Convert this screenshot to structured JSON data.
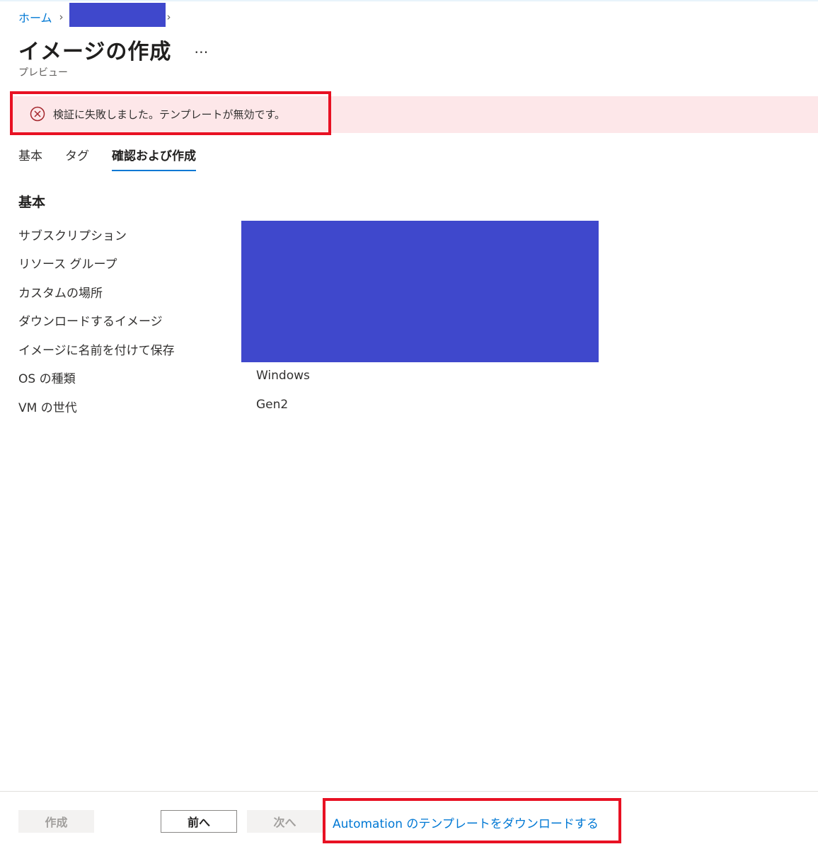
{
  "breadcrumb": {
    "home": "ホーム"
  },
  "header": {
    "title": "イメージの作成",
    "subtitle": "プレビュー",
    "more": "…"
  },
  "error": {
    "message": "検証に失敗しました。テンプレートが無効です。"
  },
  "tabs": [
    {
      "label": "基本"
    },
    {
      "label": "タグ"
    },
    {
      "label": "確認および作成",
      "active": true
    }
  ],
  "section": {
    "title": "基本",
    "rows": [
      {
        "label": "サブスクリプション",
        "value": ""
      },
      {
        "label": "リソース グループ",
        "value": ""
      },
      {
        "label": "カスタムの場所",
        "value": ""
      },
      {
        "label": "ダウンロードするイメージ",
        "value": ""
      },
      {
        "label": "イメージに名前を付けて保存",
        "value": ""
      },
      {
        "label": "OS の種類",
        "value": "Windows"
      },
      {
        "label": "VM の世代",
        "value": "Gen2"
      }
    ]
  },
  "footer": {
    "create": "作成",
    "prev": "前へ",
    "next": "次へ",
    "download_link": "Automation のテンプレートをダウンロードする"
  },
  "colors": {
    "accent": "#0078d4",
    "error": "#e81123",
    "error_bg": "#fde7e9",
    "redaction": "#3f48cc"
  }
}
